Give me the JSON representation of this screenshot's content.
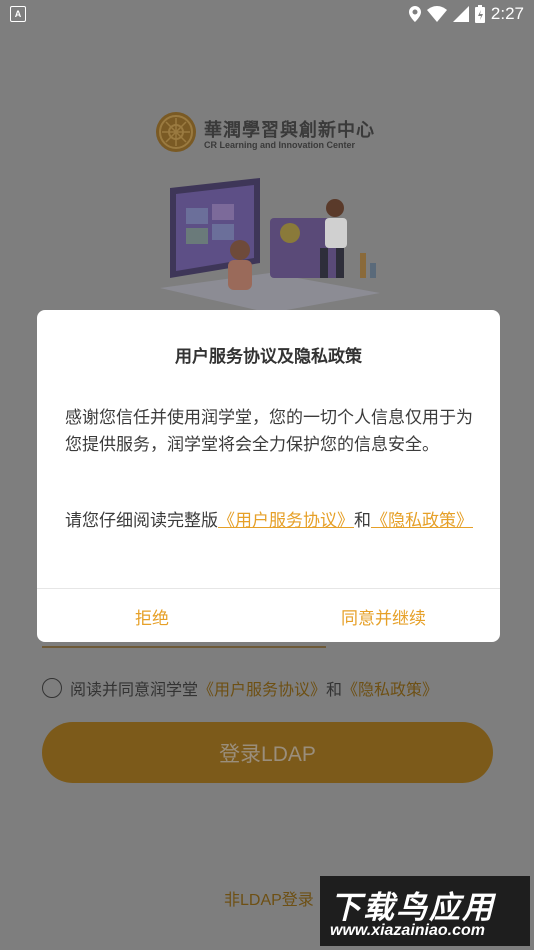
{
  "status_bar": {
    "notification_icon": "A",
    "time": "2:27",
    "icons": [
      "location-icon",
      "wifi-icon",
      "signal-icon",
      "battery-icon"
    ]
  },
  "background": {
    "logo_title": "華潤學習與創新中心",
    "logo_subtitle": "CR Learning and Innovation Center",
    "agree_prefix": "阅读并同意润学堂",
    "agree_link_service": "《用户服务协议》",
    "agree_and": "和",
    "agree_link_privacy": "《隐私政策》",
    "login_button": "登录LDAP",
    "non_ldap_login": "非LDAP登录"
  },
  "watermark": {
    "top": "下载鸟应用",
    "bottom": "www.xiazainiao.com"
  },
  "dialog": {
    "title": "用户服务协议及隐私政策",
    "body": "感谢您信任并使用润学堂，您的一切个人信息仅用于为您提供服务，润学堂将会全力保护您的信息安全。",
    "read_prefix": "请您仔细阅读完整版",
    "link_service": "《用户服务协议》",
    "and": "和",
    "link_privacy": "《隐私政策》",
    "reject": "拒绝",
    "accept": "同意并继续"
  },
  "colors": {
    "accent": "#e6a028",
    "overlay": "#7e7e7e"
  }
}
